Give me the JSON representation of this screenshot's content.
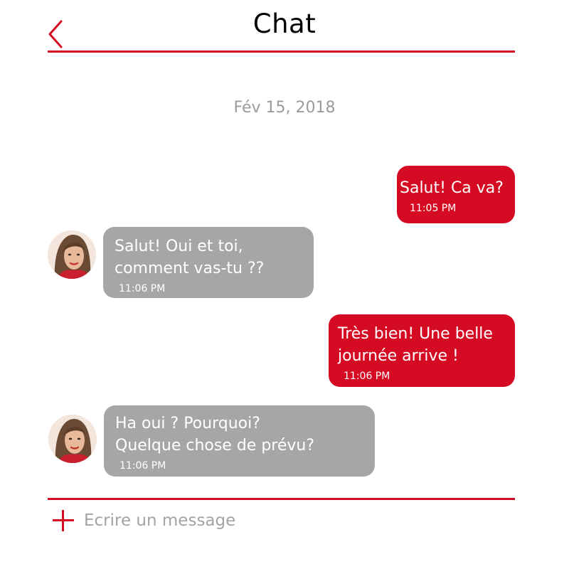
{
  "header": {
    "title": "Chat",
    "back_icon": "chevron-left-icon"
  },
  "conversation": {
    "date": "Fév 15, 2018",
    "messages": [
      {
        "direction": "outgoing",
        "lines": [
          "Salut! Ca va?"
        ],
        "time": "11:05 PM"
      },
      {
        "direction": "incoming",
        "lines": [
          "Salut! Oui et toi,",
          "comment vas-tu ??"
        ],
        "time": "11:06 PM"
      },
      {
        "direction": "outgoing",
        "lines": [
          "Très bien! Une belle",
          "journée arrive !"
        ],
        "time": "11:06 PM"
      },
      {
        "direction": "incoming",
        "lines": [
          "Ha oui ? Pourquoi?",
          "Quelque chose de prévu?"
        ],
        "time": "11:06 PM"
      }
    ]
  },
  "composer": {
    "add_icon": "plus-icon",
    "placeholder": "Ecrire un message",
    "value": ""
  },
  "colors": {
    "accent": "#d50a23",
    "incoming_bubble": "#a6a6a6",
    "date_text": "#9a9a9a"
  }
}
